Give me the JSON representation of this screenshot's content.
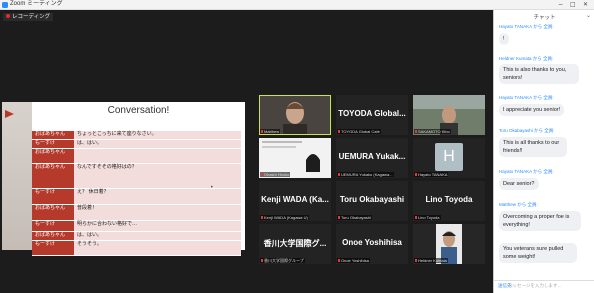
{
  "window": {
    "title": "Zoom ミーティング",
    "controls": [
      "−",
      "□",
      "✕"
    ]
  },
  "recording": {
    "label": "レコーディング"
  },
  "slide": {
    "title": "Conversation!",
    "rows": [
      {
        "speaker": "おばあちゃん",
        "text": "ちょっとこっちに来て座りなさい。"
      },
      {
        "speaker": "もーすけ",
        "text": "は、はい。"
      },
      {
        "speaker": "おばあちゃん",
        "text": ""
      },
      {
        "speaker": "おばあちゃん",
        "text": "なんですそその格好はの？"
      },
      {
        "speaker": "もーすけ",
        "text": "え？ 休日着？"
      },
      {
        "speaker": "おばあちゃん",
        "text": "普段着！"
      },
      {
        "speaker": "もーすけ",
        "text": "明らかに合わない格好で…"
      },
      {
        "speaker": "おばあちゃん",
        "text": "は、はい。"
      },
      {
        "speaker": "もーすけ",
        "text": "そうそう。"
      }
    ],
    "bullet": "•"
  },
  "tiles": [
    {
      "big": "",
      "label": "Matthew",
      "speaking": true
    },
    {
      "big": "TOYODA Global...",
      "label": "TOYODA Global Cafe"
    },
    {
      "big": "",
      "label": "SAKAMOTO Kiho"
    },
    {
      "big": "",
      "label": "Ohashi Hiroko"
    },
    {
      "big": "UEMURA Yukak...",
      "label": "UEMURA Yukako (Kagawa..."
    },
    {
      "big": "H",
      "label": "Hayato TANAKA"
    },
    {
      "big": "Kenji WADA (Ka...",
      "label": "Kenji WADA (Kagawa U)"
    },
    {
      "big": "Toru Okabayashi",
      "label": "Toru Okabayashi"
    },
    {
      "big": "Lino Toyoda",
      "label": "Lino Toyoda"
    },
    {
      "big": "香川大学国際グ...",
      "label": "香川大学国際グループ"
    },
    {
      "big": "Onoe Yoshihisa",
      "label": "Onoe Yoshihisa"
    },
    {
      "big": "",
      "label": "Heldner Kumata"
    }
  ],
  "chat": {
    "title": "チャット",
    "messages": [
      {
        "sender": "Hayato TANAKA から 全員:",
        "text": "!"
      },
      {
        "sender": "Heldner Kumata から 全員:",
        "text": "This is also thanks to you, seniors!"
      },
      {
        "sender": "Hayato TANAKA から 全員:",
        "text": "I appreciate you senior!"
      },
      {
        "sender": "Toru Okabayashi から 全員:",
        "text": "This is all thanks to our friends!!"
      },
      {
        "sender": "Hayato TANAKA から 全員:",
        "text": "Dear senior?"
      },
      {
        "sender": "Matthew から 全員:",
        "text": "Overcoming a proper foe is everything!"
      },
      {
        "sender": "",
        "text": "You veterans sure pulled some weight!"
      }
    ],
    "to_label": "送信先:",
    "placeholder": "メッセージを入力します…"
  }
}
